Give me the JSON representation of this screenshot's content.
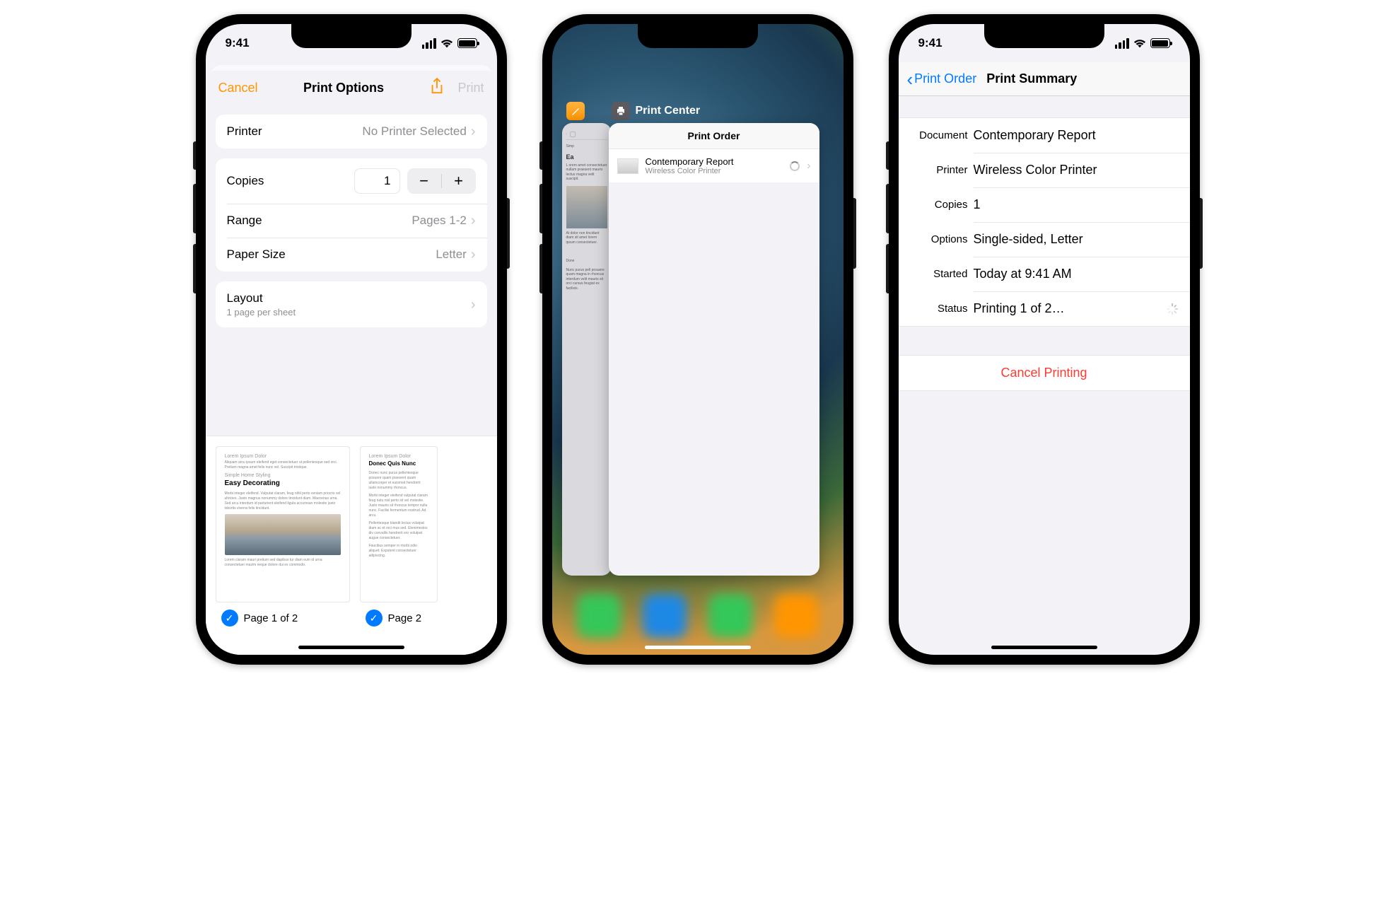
{
  "status": {
    "time": "9:41"
  },
  "screen1": {
    "nav": {
      "cancel": "Cancel",
      "title": "Print Options",
      "print": "Print"
    },
    "printer": {
      "label": "Printer",
      "value": "No Printer Selected"
    },
    "copies": {
      "label": "Copies",
      "value": "1"
    },
    "range": {
      "label": "Range",
      "value": "Pages 1-2"
    },
    "paperSize": {
      "label": "Paper Size",
      "value": "Letter"
    },
    "layout": {
      "label": "Layout",
      "sub": "1 page per sheet"
    },
    "preview": {
      "page1": {
        "lorem": "Lorem Ipsum Dolor",
        "sub": "Simple Home Styling",
        "title": "Easy Decorating",
        "label": "Page 1 of 2"
      },
      "page2": {
        "lorem": "Lorem Ipsum Dolor",
        "title": "Donec Quis Nunc",
        "label": "Page 2"
      }
    }
  },
  "screen2": {
    "pagesApp": "Pages",
    "printCenter": "Print Center",
    "printOrder": "Print Order",
    "item": {
      "title": "Contemporary Report",
      "sub": "Wireless Color Printer"
    },
    "cardPage": {
      "simp": "Simp",
      "title": "Ea",
      "donec": "Done"
    }
  },
  "screen3": {
    "back": "Print Order",
    "title": "Print Summary",
    "rows": {
      "document": {
        "k": "Document",
        "v": "Contemporary Report"
      },
      "printer": {
        "k": "Printer",
        "v": "Wireless Color Printer"
      },
      "copies": {
        "k": "Copies",
        "v": "1"
      },
      "options": {
        "k": "Options",
        "v": "Single-sided, Letter"
      },
      "started": {
        "k": "Started",
        "v": "Today at  9:41 AM"
      },
      "status": {
        "k": "Status",
        "v": "Printing 1 of 2…"
      }
    },
    "cancel": "Cancel Printing"
  }
}
